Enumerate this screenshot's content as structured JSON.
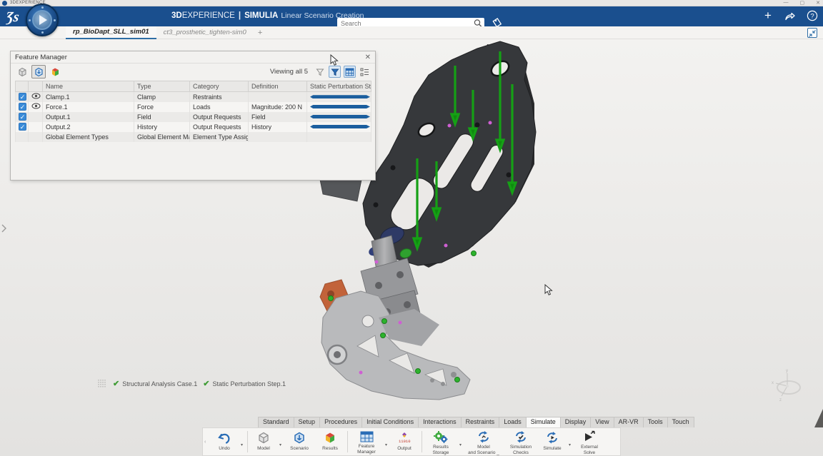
{
  "window": {
    "title": "3DEXPERIENCE",
    "minimize": "—",
    "maximize": "▢",
    "close": "✕"
  },
  "header": {
    "brand_bold": "3D",
    "brand_rest": "EXPERIENCE",
    "separator": "|",
    "app_name": "SIMULIA",
    "app_mode": "Linear Scenario Creation",
    "search_placeholder": "Search"
  },
  "doc_tabs": [
    {
      "label": "rp_BioDapt_SLL_sim01"
    },
    {
      "label": "ct3_prosthetic_tighten-sim0"
    }
  ],
  "new_tab": "+",
  "feature_manager": {
    "title": "Feature Manager",
    "viewing": "Viewing all 5",
    "columns": {
      "name": "Name",
      "type": "Type",
      "category": "Category",
      "definition": "Definition",
      "static_col": "Static Perturbation St..."
    },
    "rows": [
      {
        "name": "Clamp.1",
        "type": "Clamp",
        "category": "Restraints",
        "definition": ""
      },
      {
        "name": "Force.1",
        "type": "Force",
        "category": "Loads",
        "definition": "Magnitude: 200 N"
      },
      {
        "name": "Output.1",
        "type": "Field",
        "category": "Output Requests",
        "definition": "Field"
      },
      {
        "name": "Output.2",
        "type": "History",
        "category": "Output Requests",
        "definition": "History"
      },
      {
        "name": "Global Element Types",
        "type": "Global Element Map",
        "category": "Element Type Assign...",
        "definition": ""
      }
    ],
    "check_glyph": "✓"
  },
  "status": {
    "items": [
      {
        "label": "Structural Analysis Case.1"
      },
      {
        "label": "Static Perturbation Step.1"
      }
    ],
    "check_glyph": "✔"
  },
  "ribbon": {
    "tabs": [
      {
        "label": "Standard"
      },
      {
        "label": "Setup"
      },
      {
        "label": "Procedures"
      },
      {
        "label": "Initial Conditions"
      },
      {
        "label": "Interactions"
      },
      {
        "label": "Restraints"
      },
      {
        "label": "Loads"
      },
      {
        "label": "Simulate"
      },
      {
        "label": "Display"
      },
      {
        "label": "View"
      },
      {
        "label": "AR-VR"
      },
      {
        "label": "Tools"
      },
      {
        "label": "Touch"
      }
    ]
  },
  "toolbar": {
    "undo": "Undo",
    "model": "Model",
    "scenario": "Scenario",
    "results": "Results",
    "feature_manager": "Feature\nManager",
    "output": "Output",
    "output_binary": "11010",
    "results_storage": "Results\nStorage",
    "model_and_scenario": "Model\nand Scenario _",
    "simulation_checks": "Simulation\nChecks",
    "simulate": "Simulate",
    "external_solve": "External\nSolve",
    "caret": "▾"
  },
  "compass_triad": {
    "x": "x",
    "y": "y",
    "z": "z"
  },
  "colors": {
    "header_blue": "#1a4f8e",
    "accent_blue": "#2a6db6",
    "bar_blue": "#1b5e9e",
    "check_green": "#3f9c35",
    "checkbox_blue": "#3a8bd8",
    "tab_underline": "#2e6da4",
    "frame_dark": "#36383b",
    "foot_gray": "#b9babc",
    "clamp_orange": "#c2633a",
    "arrow_green": "#15a015"
  }
}
